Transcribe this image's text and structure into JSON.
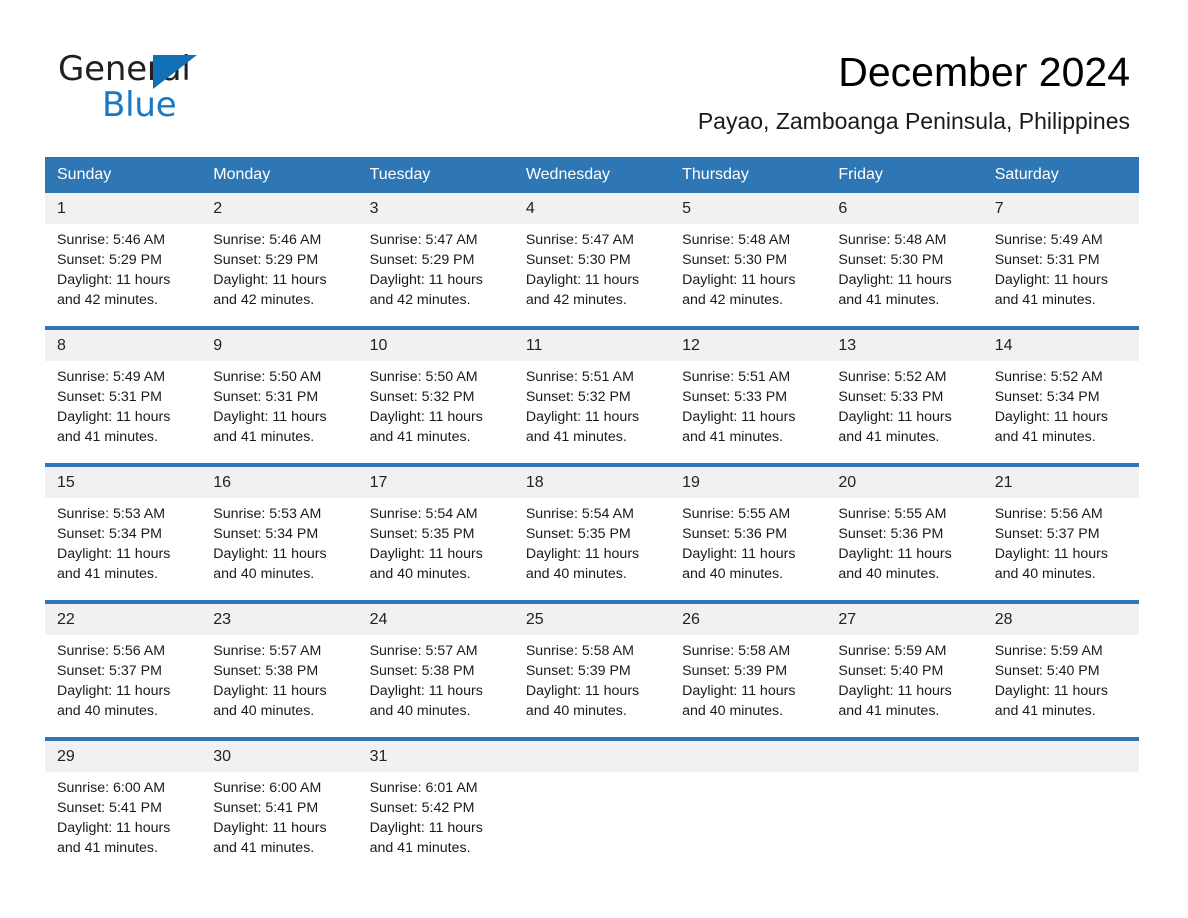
{
  "brand": {
    "name_part1": "General",
    "name_part2": "Blue",
    "triangle_color": "#1071b8",
    "blue_text_color": "#1878c4"
  },
  "header": {
    "month_title": "December 2024",
    "location": "Payao, Zamboanga Peninsula, Philippines",
    "header_bar_color": "#2f77b4",
    "daynum_band_color": "#f1f1f1"
  },
  "weekday_headers": [
    "Sunday",
    "Monday",
    "Tuesday",
    "Wednesday",
    "Thursday",
    "Friday",
    "Saturday"
  ],
  "labels": {
    "sunrise_prefix": "Sunrise:",
    "sunset_prefix": "Sunset:",
    "daylight_prefix": "Daylight:"
  },
  "weeks": [
    [
      {
        "day": "1",
        "sunrise": "Sunrise: 5:46 AM",
        "sunset": "Sunset: 5:29 PM",
        "daylight_line1": "Daylight: 11 hours",
        "daylight_line2": "and 42 minutes."
      },
      {
        "day": "2",
        "sunrise": "Sunrise: 5:46 AM",
        "sunset": "Sunset: 5:29 PM",
        "daylight_line1": "Daylight: 11 hours",
        "daylight_line2": "and 42 minutes."
      },
      {
        "day": "3",
        "sunrise": "Sunrise: 5:47 AM",
        "sunset": "Sunset: 5:29 PM",
        "daylight_line1": "Daylight: 11 hours",
        "daylight_line2": "and 42 minutes."
      },
      {
        "day": "4",
        "sunrise": "Sunrise: 5:47 AM",
        "sunset": "Sunset: 5:30 PM",
        "daylight_line1": "Daylight: 11 hours",
        "daylight_line2": "and 42 minutes."
      },
      {
        "day": "5",
        "sunrise": "Sunrise: 5:48 AM",
        "sunset": "Sunset: 5:30 PM",
        "daylight_line1": "Daylight: 11 hours",
        "daylight_line2": "and 42 minutes."
      },
      {
        "day": "6",
        "sunrise": "Sunrise: 5:48 AM",
        "sunset": "Sunset: 5:30 PM",
        "daylight_line1": "Daylight: 11 hours",
        "daylight_line2": "and 41 minutes."
      },
      {
        "day": "7",
        "sunrise": "Sunrise: 5:49 AM",
        "sunset": "Sunset: 5:31 PM",
        "daylight_line1": "Daylight: 11 hours",
        "daylight_line2": "and 41 minutes."
      }
    ],
    [
      {
        "day": "8",
        "sunrise": "Sunrise: 5:49 AM",
        "sunset": "Sunset: 5:31 PM",
        "daylight_line1": "Daylight: 11 hours",
        "daylight_line2": "and 41 minutes."
      },
      {
        "day": "9",
        "sunrise": "Sunrise: 5:50 AM",
        "sunset": "Sunset: 5:31 PM",
        "daylight_line1": "Daylight: 11 hours",
        "daylight_line2": "and 41 minutes."
      },
      {
        "day": "10",
        "sunrise": "Sunrise: 5:50 AM",
        "sunset": "Sunset: 5:32 PM",
        "daylight_line1": "Daylight: 11 hours",
        "daylight_line2": "and 41 minutes."
      },
      {
        "day": "11",
        "sunrise": "Sunrise: 5:51 AM",
        "sunset": "Sunset: 5:32 PM",
        "daylight_line1": "Daylight: 11 hours",
        "daylight_line2": "and 41 minutes."
      },
      {
        "day": "12",
        "sunrise": "Sunrise: 5:51 AM",
        "sunset": "Sunset: 5:33 PM",
        "daylight_line1": "Daylight: 11 hours",
        "daylight_line2": "and 41 minutes."
      },
      {
        "day": "13",
        "sunrise": "Sunrise: 5:52 AM",
        "sunset": "Sunset: 5:33 PM",
        "daylight_line1": "Daylight: 11 hours",
        "daylight_line2": "and 41 minutes."
      },
      {
        "day": "14",
        "sunrise": "Sunrise: 5:52 AM",
        "sunset": "Sunset: 5:34 PM",
        "daylight_line1": "Daylight: 11 hours",
        "daylight_line2": "and 41 minutes."
      }
    ],
    [
      {
        "day": "15",
        "sunrise": "Sunrise: 5:53 AM",
        "sunset": "Sunset: 5:34 PM",
        "daylight_line1": "Daylight: 11 hours",
        "daylight_line2": "and 41 minutes."
      },
      {
        "day": "16",
        "sunrise": "Sunrise: 5:53 AM",
        "sunset": "Sunset: 5:34 PM",
        "daylight_line1": "Daylight: 11 hours",
        "daylight_line2": "and 40 minutes."
      },
      {
        "day": "17",
        "sunrise": "Sunrise: 5:54 AM",
        "sunset": "Sunset: 5:35 PM",
        "daylight_line1": "Daylight: 11 hours",
        "daylight_line2": "and 40 minutes."
      },
      {
        "day": "18",
        "sunrise": "Sunrise: 5:54 AM",
        "sunset": "Sunset: 5:35 PM",
        "daylight_line1": "Daylight: 11 hours",
        "daylight_line2": "and 40 minutes."
      },
      {
        "day": "19",
        "sunrise": "Sunrise: 5:55 AM",
        "sunset": "Sunset: 5:36 PM",
        "daylight_line1": "Daylight: 11 hours",
        "daylight_line2": "and 40 minutes."
      },
      {
        "day": "20",
        "sunrise": "Sunrise: 5:55 AM",
        "sunset": "Sunset: 5:36 PM",
        "daylight_line1": "Daylight: 11 hours",
        "daylight_line2": "and 40 minutes."
      },
      {
        "day": "21",
        "sunrise": "Sunrise: 5:56 AM",
        "sunset": "Sunset: 5:37 PM",
        "daylight_line1": "Daylight: 11 hours",
        "daylight_line2": "and 40 minutes."
      }
    ],
    [
      {
        "day": "22",
        "sunrise": "Sunrise: 5:56 AM",
        "sunset": "Sunset: 5:37 PM",
        "daylight_line1": "Daylight: 11 hours",
        "daylight_line2": "and 40 minutes."
      },
      {
        "day": "23",
        "sunrise": "Sunrise: 5:57 AM",
        "sunset": "Sunset: 5:38 PM",
        "daylight_line1": "Daylight: 11 hours",
        "daylight_line2": "and 40 minutes."
      },
      {
        "day": "24",
        "sunrise": "Sunrise: 5:57 AM",
        "sunset": "Sunset: 5:38 PM",
        "daylight_line1": "Daylight: 11 hours",
        "daylight_line2": "and 40 minutes."
      },
      {
        "day": "25",
        "sunrise": "Sunrise: 5:58 AM",
        "sunset": "Sunset: 5:39 PM",
        "daylight_line1": "Daylight: 11 hours",
        "daylight_line2": "and 40 minutes."
      },
      {
        "day": "26",
        "sunrise": "Sunrise: 5:58 AM",
        "sunset": "Sunset: 5:39 PM",
        "daylight_line1": "Daylight: 11 hours",
        "daylight_line2": "and 40 minutes."
      },
      {
        "day": "27",
        "sunrise": "Sunrise: 5:59 AM",
        "sunset": "Sunset: 5:40 PM",
        "daylight_line1": "Daylight: 11 hours",
        "daylight_line2": "and 41 minutes."
      },
      {
        "day": "28",
        "sunrise": "Sunrise: 5:59 AM",
        "sunset": "Sunset: 5:40 PM",
        "daylight_line1": "Daylight: 11 hours",
        "daylight_line2": "and 41 minutes."
      }
    ],
    [
      {
        "day": "29",
        "sunrise": "Sunrise: 6:00 AM",
        "sunset": "Sunset: 5:41 PM",
        "daylight_line1": "Daylight: 11 hours",
        "daylight_line2": "and 41 minutes."
      },
      {
        "day": "30",
        "sunrise": "Sunrise: 6:00 AM",
        "sunset": "Sunset: 5:41 PM",
        "daylight_line1": "Daylight: 11 hours",
        "daylight_line2": "and 41 minutes."
      },
      {
        "day": "31",
        "sunrise": "Sunrise: 6:01 AM",
        "sunset": "Sunset: 5:42 PM",
        "daylight_line1": "Daylight: 11 hours",
        "daylight_line2": "and 41 minutes."
      },
      {
        "day": "",
        "sunrise": "",
        "sunset": "",
        "daylight_line1": "",
        "daylight_line2": ""
      },
      {
        "day": "",
        "sunrise": "",
        "sunset": "",
        "daylight_line1": "",
        "daylight_line2": ""
      },
      {
        "day": "",
        "sunrise": "",
        "sunset": "",
        "daylight_line1": "",
        "daylight_line2": ""
      },
      {
        "day": "",
        "sunrise": "",
        "sunset": "",
        "daylight_line1": "",
        "daylight_line2": ""
      }
    ]
  ]
}
